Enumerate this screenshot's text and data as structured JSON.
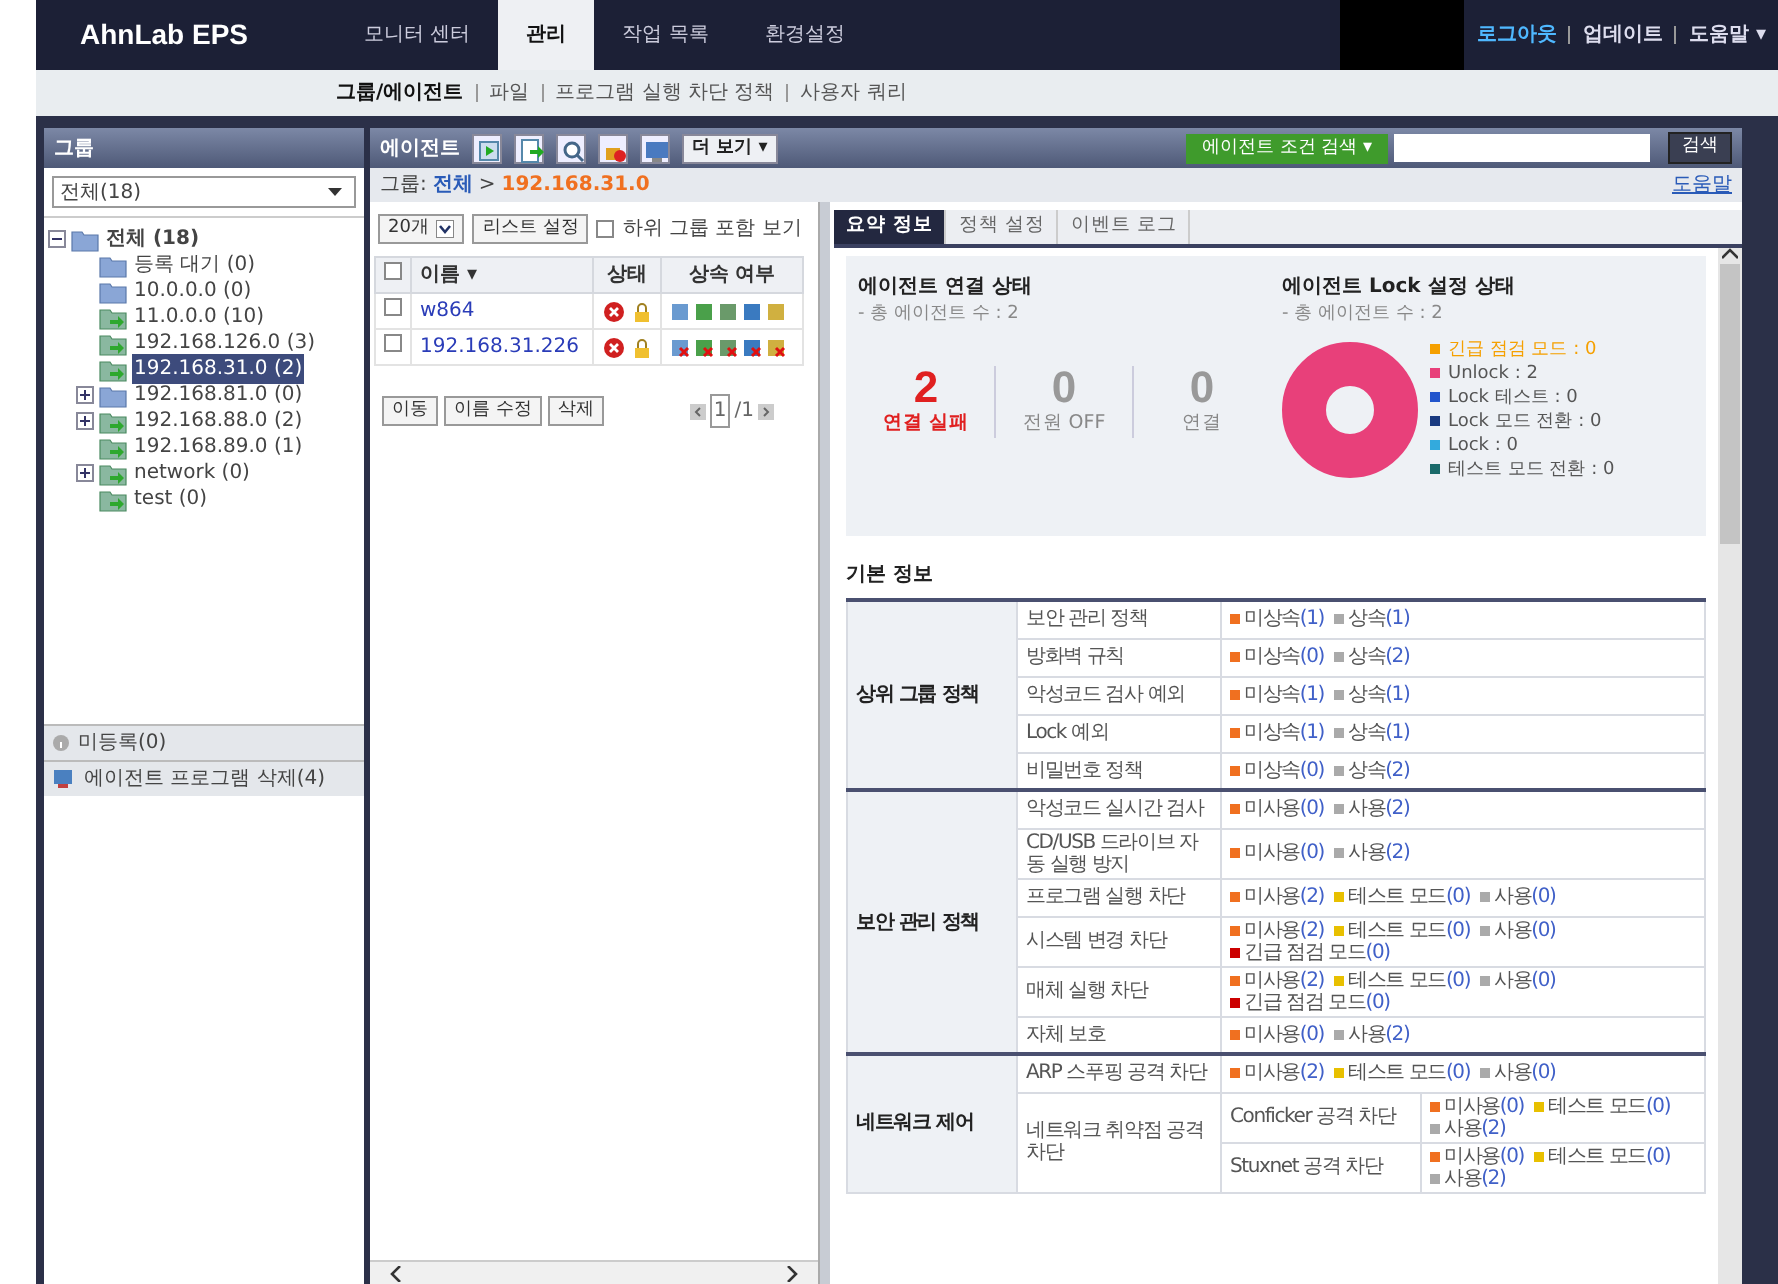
{
  "top_nav": {
    "logo": "AhnLab EPS",
    "menu": [
      {
        "label": "모니터 센터",
        "selected": false
      },
      {
        "label": "관리",
        "selected": true
      },
      {
        "label": "작업 목록",
        "selected": false
      },
      {
        "label": "환경설정",
        "selected": false
      }
    ],
    "user_links": [
      {
        "label": "로그아웃",
        "kind": "logout"
      },
      {
        "label": "업데이트",
        "kind": "link"
      },
      {
        "label": "도움말 ▾",
        "kind": "link"
      }
    ]
  },
  "sub_nav": [
    {
      "label": "그룹/에이전트",
      "selected": true
    },
    {
      "label": "파일",
      "selected": false
    },
    {
      "label": "프로그램 실행 차단 정책",
      "selected": false
    },
    {
      "label": "사용자 쿼리",
      "selected": false
    }
  ],
  "group_panel": {
    "title": "그룹",
    "filter": "전체(18)",
    "tree": [
      {
        "label": "전체 (18)",
        "kind": "folder",
        "expanded": true,
        "selected": false,
        "children": [
          {
            "label": "등록 대기 (0)",
            "kind": "folder",
            "selected": false
          },
          {
            "label": "10.0.0.0 (0)",
            "kind": "folder",
            "selected": false
          },
          {
            "label": "11.0.0.0 (10)",
            "kind": "network",
            "selected": false
          },
          {
            "label": "192.168.126.0 (3)",
            "kind": "network",
            "selected": false
          },
          {
            "label": "192.168.31.0 (2)",
            "kind": "network",
            "selected": true
          },
          {
            "label": "192.168.81.0 (0)",
            "kind": "folder",
            "expanded": false,
            "selected": false
          },
          {
            "label": "192.168.88.0 (2)",
            "kind": "network",
            "expanded": false,
            "selected": false
          },
          {
            "label": "192.168.89.0 (1)",
            "kind": "network",
            "selected": false
          },
          {
            "label": "network (0)",
            "kind": "network",
            "expanded": false,
            "selected": false
          },
          {
            "label": "test (0)",
            "kind": "network",
            "selected": false
          }
        ]
      }
    ],
    "sections": [
      {
        "label": "미등록(0)",
        "kind": "unregistered"
      },
      {
        "label": "에이전트 프로그램 삭제(4)",
        "kind": "uninstall"
      }
    ]
  },
  "agent_toolbar": {
    "title": "에이전트",
    "more": "더 보기 ▾",
    "condition_search": "에이전트 조건 검색 ▾",
    "search_button": "검색"
  },
  "breadcrumb": {
    "label": "그룹:",
    "items": [
      "전체",
      "192.168.31.0"
    ],
    "separator": ">",
    "help": "도움말"
  },
  "agent_list": {
    "select_all_checked": false,
    "page_size": "20개",
    "list_settings": "리스트 설정",
    "include_subgroups": {
      "label": "하위 그룹 포함 보기",
      "checked": false
    },
    "columns": [
      "이름 ▾",
      "상태",
      "상속 여부"
    ],
    "rows": [
      {
        "name": "w864",
        "checked": false,
        "inherited": true
      },
      {
        "name": "192.168.31.226",
        "checked": false,
        "inherited": false
      }
    ],
    "actions": [
      "이동",
      "이름 수정",
      "삭제"
    ],
    "pager": {
      "current": "1",
      "total": "/1"
    }
  },
  "detail_tabs": [
    {
      "label": "요약 정보",
      "selected": true
    },
    {
      "label": "정책 설정",
      "selected": false
    },
    {
      "label": "이벤트 로그",
      "selected": false
    }
  ],
  "connection_status": {
    "title": "에이전트 연결 상태",
    "subtitle": "- 총 에이전트 수 : 2",
    "stats": [
      {
        "value": "2",
        "label": "연결 실패",
        "kind": "alert"
      },
      {
        "value": "0",
        "label": "전원 OFF",
        "kind": "normal"
      },
      {
        "value": "0",
        "label": "연결",
        "kind": "normal"
      }
    ]
  },
  "lock_status": {
    "title": "에이전트 Lock 설정 상태",
    "subtitle": "- 총 에이전트 수 : 2",
    "legend": [
      {
        "label": "긴급 점검 모드 : 0",
        "color": "#f5a000",
        "kind": "alert"
      },
      {
        "label": "Unlock : 2",
        "color": "#e8407a",
        "kind": "normal"
      },
      {
        "label": "Lock 테스트 : 0",
        "color": "#2255cc",
        "kind": "normal"
      },
      {
        "label": "Lock 모드 전환 : 0",
        "color": "#1a3a80",
        "kind": "normal"
      },
      {
        "label": "Lock : 0",
        "color": "#33aadd",
        "kind": "normal"
      },
      {
        "label": "테스트 모드 전환 : 0",
        "color": "#1a6a6a",
        "kind": "normal"
      }
    ]
  },
  "basic_info": {
    "title": "기본 정보",
    "groups": [
      {
        "label": "상위 그룹 정책",
        "rows": [
          {
            "label": "보안 관리 정책",
            "statuses": [
              {
                "label": "미상속",
                "count": "(1)",
                "color": "#f07020"
              },
              {
                "label": "상속",
                "count": "(1)",
                "color": "#aaaaaa"
              }
            ]
          },
          {
            "label": "방화벽 규칙",
            "statuses": [
              {
                "label": "미상속",
                "count": "(0)",
                "color": "#f07020"
              },
              {
                "label": "상속",
                "count": "(2)",
                "color": "#aaaaaa"
              }
            ]
          },
          {
            "label": "악성코드 검사 예외",
            "statuses": [
              {
                "label": "미상속",
                "count": "(1)",
                "color": "#f07020"
              },
              {
                "label": "상속",
                "count": "(1)",
                "color": "#aaaaaa"
              }
            ]
          },
          {
            "label": "Lock 예외",
            "statuses": [
              {
                "label": "미상속",
                "count": "(1)",
                "color": "#f07020"
              },
              {
                "label": "상속",
                "count": "(1)",
                "color": "#aaaaaa"
              }
            ]
          },
          {
            "label": "비밀번호 정책",
            "statuses": [
              {
                "label": "미상속",
                "count": "(0)",
                "color": "#f07020"
              },
              {
                "label": "상속",
                "count": "(2)",
                "color": "#aaaaaa"
              }
            ]
          }
        ]
      },
      {
        "label": "보안 관리 정책",
        "rows": [
          {
            "label": "악성코드 실시간 검사",
            "statuses": [
              {
                "label": "미사용",
                "count": "(0)",
                "color": "#f07020"
              },
              {
                "label": "사용",
                "count": "(2)",
                "color": "#aaaaaa"
              }
            ]
          },
          {
            "label": "CD/USB 드라이브 자동 실행 방지",
            "statuses": [
              {
                "label": "미사용",
                "count": "(0)",
                "color": "#f07020"
              },
              {
                "label": "사용",
                "count": "(2)",
                "color": "#aaaaaa"
              }
            ]
          },
          {
            "label": "프로그램 실행 차단",
            "statuses": [
              {
                "label": "미사용",
                "count": "(2)",
                "color": "#f07020"
              },
              {
                "label": "테스트 모드",
                "count": "(0)",
                "color": "#e8c000"
              },
              {
                "label": "사용",
                "count": "(0)",
                "color": "#aaaaaa"
              }
            ]
          },
          {
            "label": "시스템 변경 차단",
            "statuses": [
              {
                "label": "미사용",
                "count": "(2)",
                "color": "#f07020"
              },
              {
                "label": "테스트 모드",
                "count": "(0)",
                "color": "#e8c000"
              },
              {
                "label": "사용",
                "count": "(0)",
                "color": "#aaaaaa"
              },
              {
                "label": "긴급 점검 모드",
                "count": "(0)",
                "color": "#cc0000"
              }
            ]
          },
          {
            "label": "매체 실행 차단",
            "statuses": [
              {
                "label": "미사용",
                "count": "(2)",
                "color": "#f07020"
              },
              {
                "label": "테스트 모드",
                "count": "(0)",
                "color": "#e8c000"
              },
              {
                "label": "사용",
                "count": "(0)",
                "color": "#aaaaaa"
              },
              {
                "label": "긴급 점검 모드",
                "count": "(0)",
                "color": "#cc0000"
              }
            ]
          },
          {
            "label": "자체 보호",
            "statuses": [
              {
                "label": "미사용",
                "count": "(0)",
                "color": "#f07020"
              },
              {
                "label": "사용",
                "count": "(2)",
                "color": "#aaaaaa"
              }
            ]
          }
        ]
      },
      {
        "label": "네트워크 제어",
        "rows": [
          {
            "label": "ARP 스푸핑 공격 차단",
            "statuses": [
              {
                "label": "미사용",
                "count": "(2)",
                "color": "#f07020"
              },
              {
                "label": "테스트 모드",
                "count": "(0)",
                "color": "#e8c000"
              },
              {
                "label": "사용",
                "count": "(0)",
                "color": "#aaaaaa"
              }
            ]
          },
          {
            "label": "네트워크 취약점 공격 차단",
            "children": [
              {
                "label": "Conficker 공격 차단",
                "statuses": [
                  {
                    "label": "미사용",
                    "count": "(0)",
                    "color": "#f07020"
                  },
                  {
                    "label": "테스트 모드",
                    "count": "(0)",
                    "color": "#e8c000"
                  },
                  {
                    "label": "사용",
                    "count": "(2)",
                    "color": "#aaaaaa"
                  }
                ]
              },
              {
                "label": "Stuxnet 공격 차단",
                "statuses": [
                  {
                    "label": "미사용",
                    "count": "(0)",
                    "color": "#f07020"
                  },
                  {
                    "label": "테스트 모드",
                    "count": "(0)",
                    "color": "#e8c000"
                  },
                  {
                    "label": "사용",
                    "count": "(2)",
                    "color": "#aaaaaa"
                  }
                ]
              }
            ]
          }
        ]
      }
    ]
  }
}
